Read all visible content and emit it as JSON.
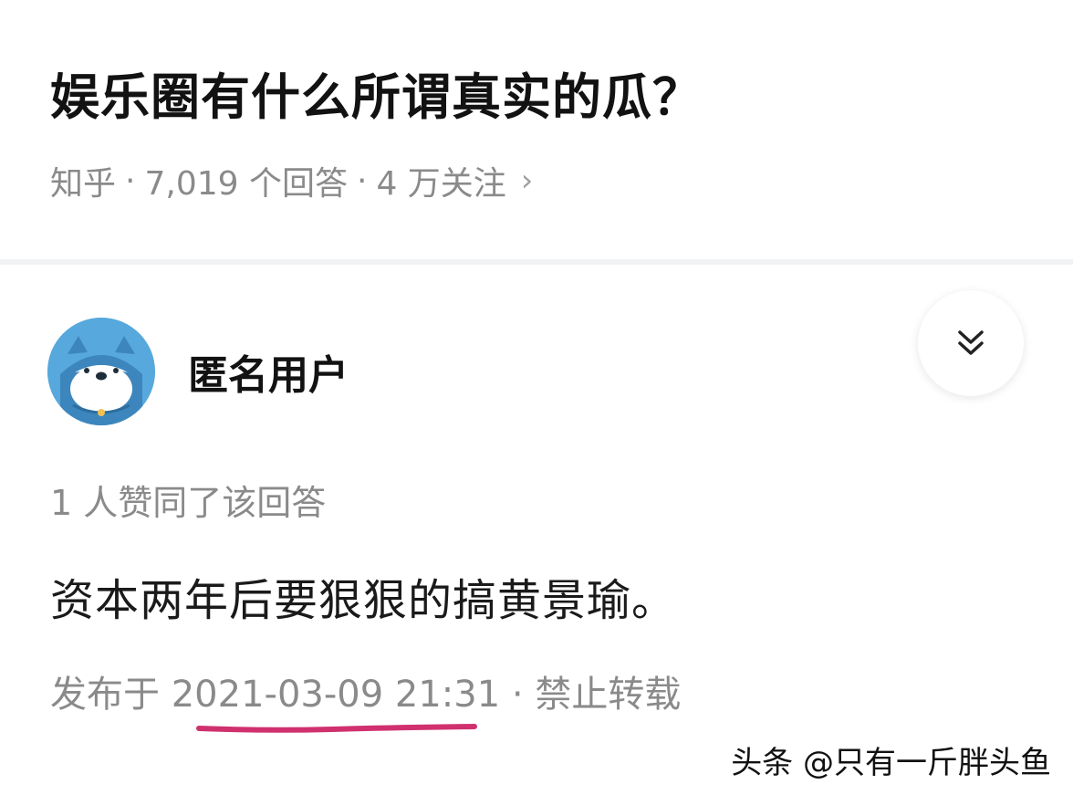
{
  "question": {
    "title": "娱乐圈有什么所谓真实的瓜？",
    "source": "知乎",
    "answers_count": "7,019 个回答",
    "followers": "4 万关注",
    "separator": "·"
  },
  "answer": {
    "author_name": "匿名用户",
    "avatar_icon": "anonymous-husky-avatar",
    "votes_text": "1 人赞同了该回答",
    "content": "资本两年后要狠狠的搞黄景瑜。",
    "publish_prefix": "发布于 ",
    "publish_time": "2021-03-09 21:31",
    "publish_suffix": " · 禁止转载",
    "collapse_icon": "double-chevron-down-icon"
  },
  "annotation": {
    "underline_color": "#d0306e"
  },
  "watermark": {
    "text": "头条 @只有一斤胖头鱼"
  }
}
